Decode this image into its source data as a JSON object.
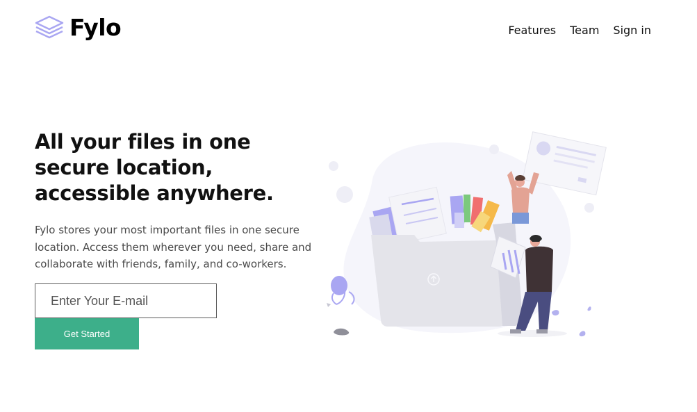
{
  "brand": {
    "name": "Fylo",
    "accent": "#3daf8a",
    "icon": "stacked-layers-icon"
  },
  "nav": {
    "items": [
      {
        "label": "Features"
      },
      {
        "label": "Team"
      },
      {
        "label": "Sign in"
      }
    ]
  },
  "hero": {
    "title": "All your files in one secure location, accessible anywhere.",
    "description": "Fylo stores your most important files in one secure location. Access them wherever you need, share and collaborate with friends, family, and co-workers."
  },
  "form": {
    "email_placeholder": "Enter Your E-mail",
    "submit_label": "Get Started"
  },
  "illustration": {
    "name": "people-with-files-illustration",
    "upload_icon": "upload-arrow-icon"
  }
}
